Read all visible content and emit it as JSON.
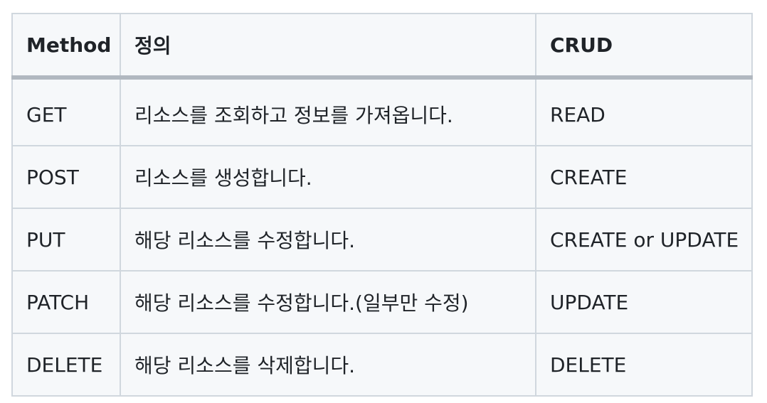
{
  "table": {
    "headers": {
      "method": "Method",
      "definition": "정의",
      "crud": "CRUD"
    },
    "rows": [
      {
        "method": "GET",
        "definition": "리소스를 조회하고 정보를 가져옵니다.",
        "crud": "READ"
      },
      {
        "method": "POST",
        "definition": "리소스를 생성합니다.",
        "crud": "CREATE"
      },
      {
        "method": "PUT",
        "definition": "해당 리소스를 수정합니다.",
        "crud": "CREATE or UPDATE"
      },
      {
        "method": "PATCH",
        "definition": "해당 리소스를 수정합니다.(일부만 수정)",
        "crud": "UPDATE"
      },
      {
        "method": "DELETE",
        "definition": "해당 리소스를 삭제합니다.",
        "crud": "DELETE"
      }
    ]
  },
  "colors": {
    "border": "#d0d7de",
    "header_rule": "#b1b8c0",
    "cell_background": "#f6f8fa",
    "text": "#1f2328"
  }
}
